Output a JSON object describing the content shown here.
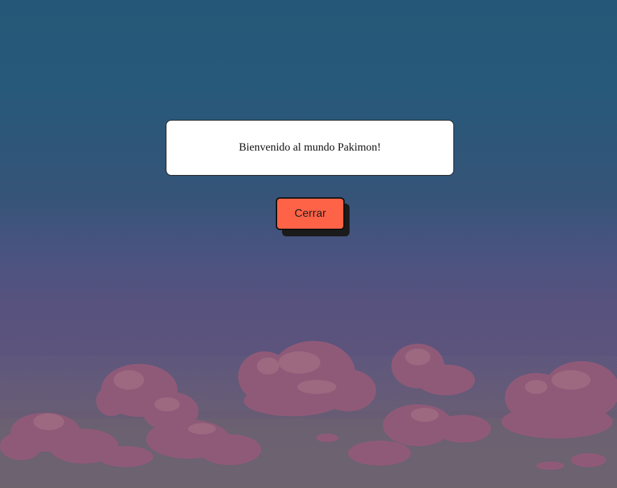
{
  "dialog": {
    "message": "Bienvenido al mundo Pakimon!"
  },
  "close_button": {
    "label": "Cerrar"
  },
  "colors": {
    "sky_top": "#255878",
    "sky_bottom": "#6e6270",
    "cloud": "#8f5a78",
    "cloud_highlight": "#a06c82",
    "button_bg": "#ff6347",
    "button_shadow": "#1b1b1b",
    "dialog_bg": "#ffffff"
  }
}
